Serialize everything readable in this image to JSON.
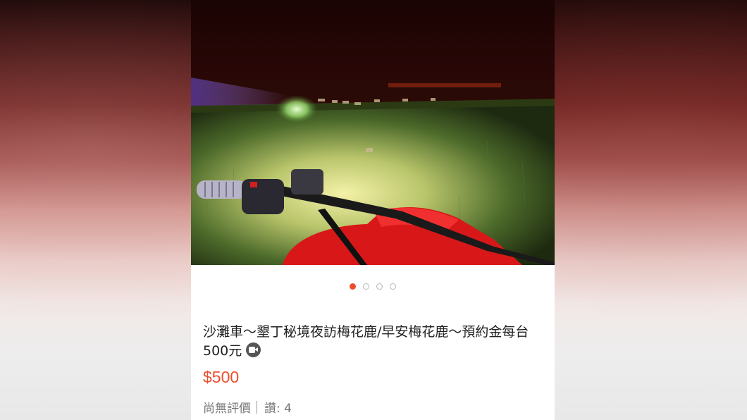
{
  "listing": {
    "title": "沙灘車～墾丁秘境夜訪梅花鹿/早安梅花鹿～預約金每台500元",
    "price": "$500",
    "rating_text": "尚無評價",
    "likes_text": "讚: 4",
    "carousel": {
      "total": 4,
      "active_index": 0
    }
  },
  "icons": {
    "video": "video-camera-icon"
  },
  "colors": {
    "accent": "#ee4d2d",
    "title_text": "#222222",
    "meta_text": "#777777"
  }
}
